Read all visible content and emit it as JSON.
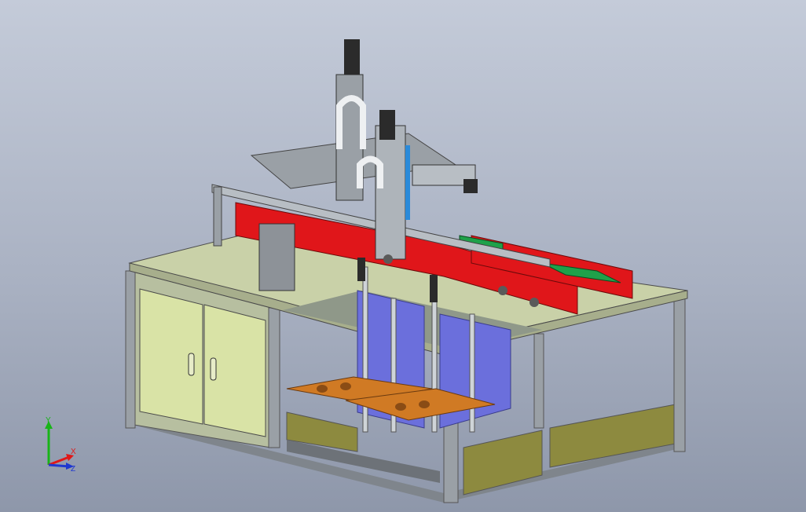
{
  "viewport": {
    "background_top": "#c4cbd9",
    "background_bottom": "#8e97aa"
  },
  "model": {
    "colors": {
      "cabinet_panel": "#d9e3a6",
      "table_top": "#c9d1a8",
      "frame": "#9aa0a6",
      "red_beam": "#e0161a",
      "green_plate": "#1fa14a",
      "blue_block": "#6b6fdc",
      "orange_tray": "#d07a24",
      "olive_panel": "#8d8a3f"
    }
  },
  "triad": {
    "y_label": "Y",
    "x_label": "X",
    "z_label": "Z",
    "colors": {
      "y": "#18b418",
      "x": "#e01818",
      "z": "#2038d0"
    }
  }
}
